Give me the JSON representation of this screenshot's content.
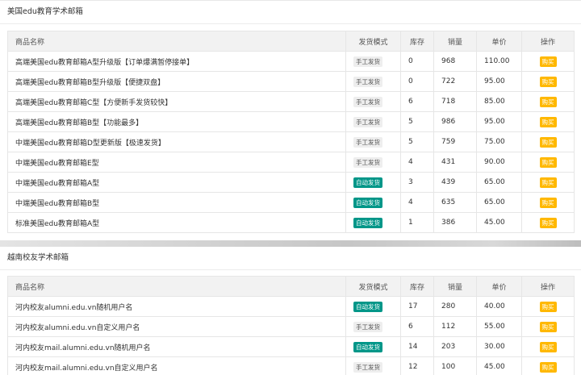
{
  "sections": [
    {
      "title": "美国edu教育学术邮箱",
      "headers": [
        "商品名称",
        "发货模式",
        "库存",
        "销量",
        "单价",
        "操作"
      ],
      "rows": [
        {
          "name": "高端美国edu教育邮箱A型升级版【订单爆满暂停接单】",
          "mode": "手工发货",
          "auto": false,
          "stock": "0",
          "sales": "968",
          "price": "110.00",
          "action": "购买"
        },
        {
          "name": "高端美国edu教育邮箱B型升级版【便捷双盘】",
          "mode": "手工发货",
          "auto": false,
          "stock": "0",
          "sales": "722",
          "price": "95.00",
          "action": "购买"
        },
        {
          "name": "高端美国edu教育邮箱C型【方便新手发货较快】",
          "mode": "手工发货",
          "auto": false,
          "stock": "6",
          "sales": "718",
          "price": "85.00",
          "action": "购买"
        },
        {
          "name": "高端美国edu教育邮箱B型【功能最多】",
          "mode": "手工发货",
          "auto": false,
          "stock": "5",
          "sales": "986",
          "price": "95.00",
          "action": "购买"
        },
        {
          "name": "中端美国edu教育邮箱D型更新版【极速发货】",
          "mode": "手工发货",
          "auto": false,
          "stock": "5",
          "sales": "759",
          "price": "75.00",
          "action": "购买"
        },
        {
          "name": "中端美国edu教育邮箱E型",
          "mode": "手工发货",
          "auto": false,
          "stock": "4",
          "sales": "431",
          "price": "90.00",
          "action": "购买"
        },
        {
          "name": "中端美国edu教育邮箱A型",
          "mode": "自动发货",
          "auto": true,
          "stock": "3",
          "sales": "439",
          "price": "65.00",
          "action": "购买"
        },
        {
          "name": "中端美国edu教育邮箱B型",
          "mode": "自动发货",
          "auto": true,
          "stock": "4",
          "sales": "635",
          "price": "65.00",
          "action": "购买"
        },
        {
          "name": "标准美国edu教育邮箱A型",
          "mode": "自动发货",
          "auto": true,
          "stock": "1",
          "sales": "386",
          "price": "45.00",
          "action": "购买"
        }
      ]
    },
    {
      "title": "越南校友学术邮箱",
      "headers": [
        "商品名称",
        "发货模式",
        "库存",
        "销量",
        "单价",
        "操作"
      ],
      "rows": [
        {
          "name": "河内校友alumni.edu.vn随机用户名",
          "mode": "自动发货",
          "auto": true,
          "stock": "17",
          "sales": "280",
          "price": "40.00",
          "action": "购买"
        },
        {
          "name": "河内校友alumni.edu.vn自定义用户名",
          "mode": "手工发货",
          "auto": false,
          "stock": "6",
          "sales": "112",
          "price": "55.00",
          "action": "购买"
        },
        {
          "name": "河内校友mail.alumni.edu.vn随机用户名",
          "mode": "自动发货",
          "auto": true,
          "stock": "14",
          "sales": "203",
          "price": "30.00",
          "action": "购买"
        },
        {
          "name": "河内校友mail.alumni.edu.vn自定义用户名",
          "mode": "手工发货",
          "auto": false,
          "stock": "12",
          "sales": "100",
          "price": "45.00",
          "action": "购买"
        }
      ]
    }
  ],
  "colors": {
    "auto_badge": "#009688",
    "manual_badge": "#eeeeee",
    "buy_button": "#ffb800",
    "header_bg": "#f2f2f2"
  }
}
